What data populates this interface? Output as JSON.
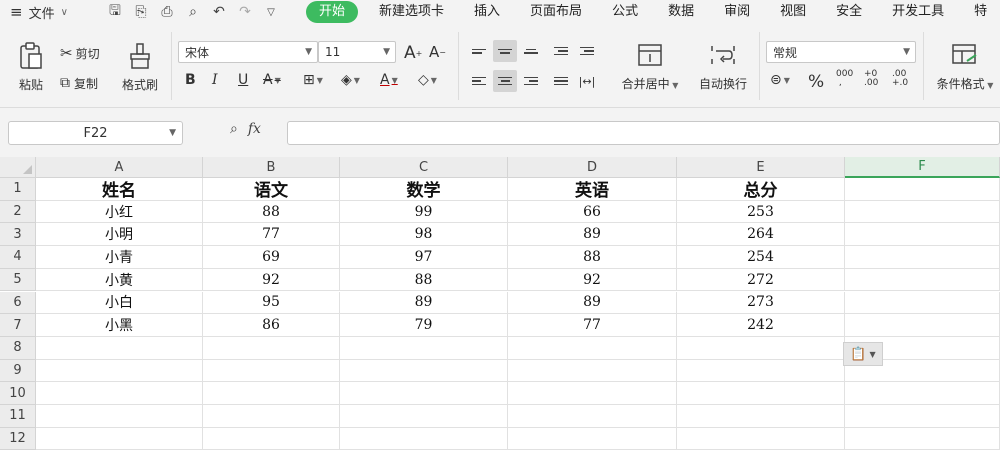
{
  "menu": {
    "file_label": "文件",
    "tabs": [
      "开始",
      "新建选项卡",
      "插入",
      "页面布局",
      "公式",
      "数据",
      "审阅",
      "视图",
      "安全",
      "开发工具",
      "特"
    ],
    "active_tab": "开始"
  },
  "ribbon": {
    "paste_label": "粘贴",
    "cut_label": "剪切",
    "copy_label": "复制",
    "format_painter_label": "格式刷",
    "font_name": "宋体",
    "font_size": "11",
    "merge_center_label": "合并居中",
    "wrap_text_label": "自动换行",
    "number_format": "常规",
    "conditional_format_label": "条件格式"
  },
  "formula_bar": {
    "name_box": "F22",
    "fx_label": "fx",
    "formula": ""
  },
  "sheet": {
    "columns": [
      "A",
      "B",
      "C",
      "D",
      "E",
      "F"
    ],
    "rows": [
      "1",
      "2",
      "3",
      "4",
      "5",
      "6",
      "7",
      "8",
      "9",
      "10",
      "11",
      "12"
    ],
    "header": [
      "姓名",
      "语文",
      "数学",
      "英语",
      "总分"
    ],
    "data": [
      [
        "小红",
        "88",
        "99",
        "66",
        "253"
      ],
      [
        "小明",
        "77",
        "98",
        "89",
        "264"
      ],
      [
        "小青",
        "69",
        "97",
        "88",
        "254"
      ],
      [
        "小黄",
        "92",
        "88",
        "92",
        "272"
      ],
      [
        "小白",
        "95",
        "89",
        "89",
        "273"
      ],
      [
        "小黑",
        "86",
        "79",
        "77",
        "242"
      ]
    ]
  },
  "colors": {
    "accent_green": "#3dbb60",
    "selected_col": "#3aa55a"
  }
}
